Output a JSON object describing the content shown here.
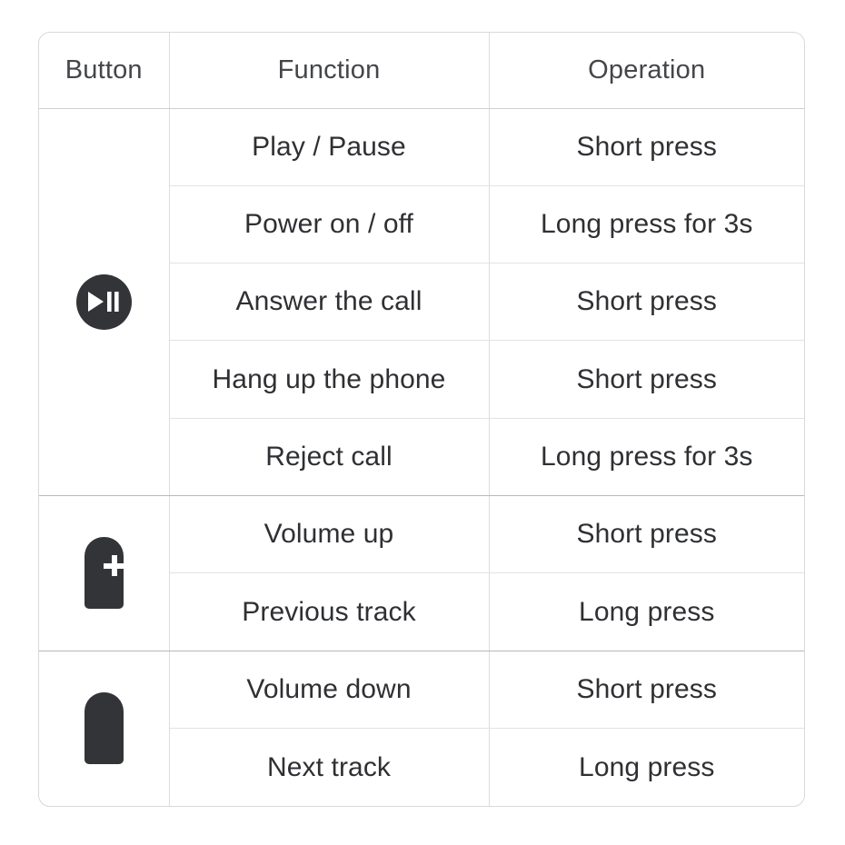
{
  "table": {
    "headers": {
      "button": "Button",
      "function": "Function",
      "operation": "Operation"
    },
    "groups": [
      {
        "icon": "play-pause-icon",
        "icon_label": "Play / Pause button",
        "rows": [
          {
            "function": "Play / Pause",
            "operation": "Short press"
          },
          {
            "function": "Power on / off",
            "operation": "Long press for 3s"
          },
          {
            "function": "Answer the call",
            "operation": "Short press"
          },
          {
            "function": "Hang up the phone",
            "operation": "Short press"
          },
          {
            "function": "Reject call",
            "operation": "Long press for 3s"
          }
        ]
      },
      {
        "icon": "volume-up-icon",
        "icon_label": "Volume up button",
        "rows": [
          {
            "function": "Volume up",
            "operation": "Short press"
          },
          {
            "function": "Previous track",
            "operation": "Long press"
          }
        ]
      },
      {
        "icon": "volume-down-icon",
        "icon_label": "Volume down button",
        "rows": [
          {
            "function": "Volume down",
            "operation": "Short press"
          },
          {
            "function": "Next track",
            "operation": "Long press"
          }
        ]
      }
    ]
  },
  "colors": {
    "icon_fill": "#333438",
    "icon_glyph": "#ffffff",
    "text": "#2f3033",
    "header_text": "#45464a",
    "border": "#d9d9d9",
    "group_border": "#b9b9b9",
    "row_border": "#e3e3e3",
    "background": "#ffffff"
  }
}
